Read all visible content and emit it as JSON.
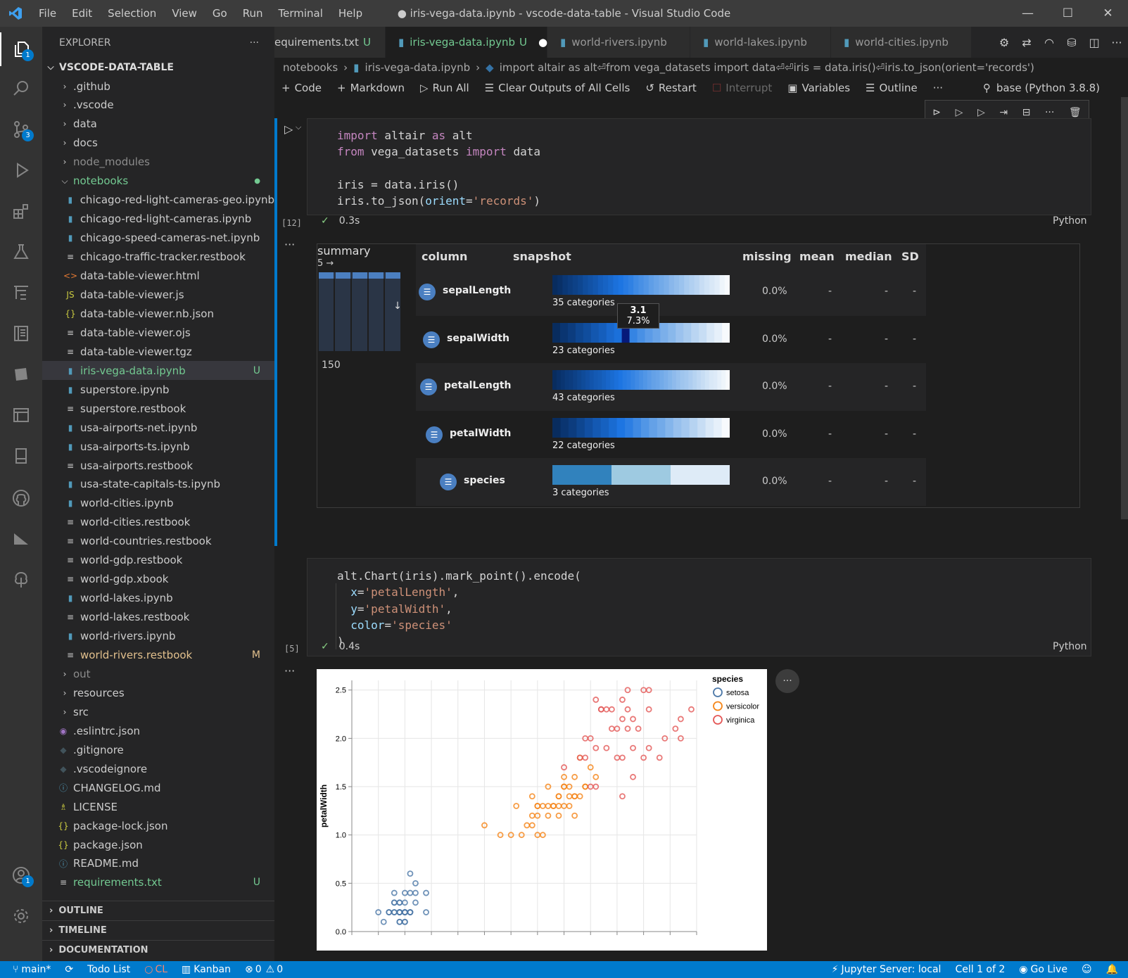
{
  "window": {
    "title": "● iris-vega-data.ipynb - vscode-data-table - Visual Studio Code",
    "menu": [
      "File",
      "Edit",
      "Selection",
      "View",
      "Go",
      "Run",
      "Terminal",
      "Help"
    ]
  },
  "activity": {
    "explorer_badge": "1",
    "scm_badge": "3",
    "account_badge": "1"
  },
  "explorer": {
    "header": "EXPLORER",
    "root": "VSCODE-DATA-TABLE",
    "items": [
      {
        "label": ".github",
        "kind": "folder"
      },
      {
        "label": ".vscode",
        "kind": "folder"
      },
      {
        "label": "data",
        "kind": "folder"
      },
      {
        "label": "docs",
        "kind": "folder"
      },
      {
        "label": "node_modules",
        "kind": "folder"
      },
      {
        "label": "notebooks",
        "kind": "folder-open"
      },
      {
        "label": "chicago-red-light-cameras-geo.ipynb",
        "kind": "nb"
      },
      {
        "label": "chicago-red-light-cameras.ipynb",
        "kind": "nb"
      },
      {
        "label": "chicago-speed-cameras-net.ipynb",
        "kind": "nb"
      },
      {
        "label": "chicago-traffic-tracker.restbook",
        "kind": "rb"
      },
      {
        "label": "data-table-viewer.html",
        "kind": "html"
      },
      {
        "label": "data-table-viewer.js",
        "kind": "js"
      },
      {
        "label": "data-table-viewer.nb.json",
        "kind": "json"
      },
      {
        "label": "data-table-viewer.ojs",
        "kind": "rb"
      },
      {
        "label": "data-table-viewer.tgz",
        "kind": "rb"
      },
      {
        "label": "iris-vega-data.ipynb",
        "kind": "nb",
        "badge": "U"
      },
      {
        "label": "superstore.ipynb",
        "kind": "nb"
      },
      {
        "label": "superstore.restbook",
        "kind": "rb"
      },
      {
        "label": "usa-airports-net.ipynb",
        "kind": "nb"
      },
      {
        "label": "usa-airports-ts.ipynb",
        "kind": "nb"
      },
      {
        "label": "usa-airports.restbook",
        "kind": "rb"
      },
      {
        "label": "usa-state-capitals-ts.ipynb",
        "kind": "nb"
      },
      {
        "label": "world-cities.ipynb",
        "kind": "nb"
      },
      {
        "label": "world-cities.restbook",
        "kind": "rb"
      },
      {
        "label": "world-countries.restbook",
        "kind": "rb"
      },
      {
        "label": "world-gdp.restbook",
        "kind": "rb"
      },
      {
        "label": "world-gdp.xbook",
        "kind": "rb"
      },
      {
        "label": "world-lakes.ipynb",
        "kind": "nb"
      },
      {
        "label": "world-lakes.restbook",
        "kind": "rb"
      },
      {
        "label": "world-rivers.ipynb",
        "kind": "nb"
      },
      {
        "label": "world-rivers.restbook",
        "kind": "rb",
        "badge": "M"
      },
      {
        "label": "out",
        "kind": "folder"
      },
      {
        "label": "resources",
        "kind": "folder"
      },
      {
        "label": "src",
        "kind": "folder"
      },
      {
        "label": ".eslintrc.json",
        "kind": "eslint"
      },
      {
        "label": ".gitignore",
        "kind": "git"
      },
      {
        "label": ".vscodeignore",
        "kind": "git"
      },
      {
        "label": "CHANGELOG.md",
        "kind": "info"
      },
      {
        "label": "LICENSE",
        "kind": "license"
      },
      {
        "label": "package-lock.json",
        "kind": "json"
      },
      {
        "label": "package.json",
        "kind": "json"
      },
      {
        "label": "README.md",
        "kind": "info"
      },
      {
        "label": "requirements.txt",
        "kind": "rb",
        "badge": "U"
      }
    ],
    "sections": [
      "OUTLINE",
      "TIMELINE",
      "DOCUMENTATION"
    ]
  },
  "tabs": [
    {
      "label": "equirements.txt",
      "badge": "U"
    },
    {
      "label": "iris-vega-data.ipynb",
      "badge": "U",
      "dirty": "●"
    },
    {
      "label": "world-rivers.ipynb"
    },
    {
      "label": "world-lakes.ipynb"
    },
    {
      "label": "world-cities.ipynb"
    }
  ],
  "breadcrumbs": [
    "notebooks",
    "iris-vega-data.ipynb",
    "import altair as alt⏎from vega_datasets import data⏎⏎iris = data.iris()⏎iris.to_json(orient='records')"
  ],
  "toolbar": {
    "code": "Code",
    "markdown": "Markdown",
    "run_all": "Run All",
    "clear": "Clear Outputs of All Cells",
    "restart": "Restart",
    "interrupt": "Interrupt",
    "variables": "Variables",
    "outline": "Outline",
    "kernel": "base (Python 3.8.8)"
  },
  "cell1": {
    "count": "[12]",
    "time": "0.3s",
    "lang": "Python"
  },
  "cell2": {
    "count": "[5]",
    "time": "0.4s",
    "lang": "Python"
  },
  "datatable": {
    "summary_label": "summary",
    "summary_cols": "5 →",
    "summary_rows": "150",
    "headers": [
      "column",
      "snapshot",
      "missing",
      "mean",
      "median",
      "SD"
    ],
    "rows": [
      {
        "name": "sepalLength",
        "categories": "35 categories",
        "missing": "0.0%",
        "mean": "-",
        "median": "-",
        "sd": "-"
      },
      {
        "name": "sepalWidth",
        "categories": "23 categories",
        "missing": "0.0%",
        "mean": "-",
        "median": "-",
        "sd": "-"
      },
      {
        "name": "petalLength",
        "categories": "43 categories",
        "missing": "0.0%",
        "mean": "-",
        "median": "-",
        "sd": "-"
      },
      {
        "name": "petalWidth",
        "categories": "22 categories",
        "missing": "0.0%",
        "mean": "-",
        "median": "-",
        "sd": "-"
      },
      {
        "name": "species",
        "categories": "3 categories",
        "missing": "0.0%",
        "mean": "-",
        "median": "-",
        "sd": "-"
      }
    ],
    "tooltip": {
      "value": "3.1",
      "pct": "7.3%"
    }
  },
  "chart_data": {
    "type": "scatter",
    "title": "",
    "xlabel": "",
    "ylabel": "petalWidth",
    "ylim": [
      0,
      2.6
    ],
    "xlim": [
      0.5,
      7.0
    ],
    "yticks": [
      "0.0",
      "0.5",
      "1.0",
      "1.5",
      "2.0",
      "2.5"
    ],
    "grid": true,
    "legend": {
      "title": "species",
      "placement": "right",
      "entries": [
        "setosa",
        "versicolor",
        "virginica"
      ]
    },
    "colors": {
      "setosa": "#4c78a8",
      "versicolor": "#f58518",
      "virginica": "#e45756"
    },
    "series": [
      {
        "name": "setosa",
        "points": [
          [
            1.4,
            0.2
          ],
          [
            1.3,
            0.2
          ],
          [
            1.5,
            0.2
          ],
          [
            1.4,
            0.2
          ],
          [
            1.7,
            0.4
          ],
          [
            1.4,
            0.3
          ],
          [
            1.5,
            0.2
          ],
          [
            1.5,
            0.1
          ],
          [
            1.6,
            0.2
          ],
          [
            1.4,
            0.1
          ],
          [
            1.1,
            0.1
          ],
          [
            1.2,
            0.2
          ],
          [
            1.5,
            0.4
          ],
          [
            1.3,
            0.4
          ],
          [
            1.7,
            0.3
          ],
          [
            1.5,
            0.3
          ],
          [
            1.0,
            0.2
          ],
          [
            1.7,
            0.5
          ],
          [
            1.9,
            0.2
          ],
          [
            1.6,
            0.4
          ],
          [
            1.6,
            0.2
          ],
          [
            1.5,
            0.2
          ],
          [
            1.4,
            0.2
          ],
          [
            1.6,
            0.2
          ],
          [
            1.3,
            0.3
          ],
          [
            1.3,
            0.3
          ],
          [
            1.5,
            0.1
          ],
          [
            1.9,
            0.4
          ],
          [
            1.6,
            0.6
          ],
          [
            1.4,
            0.3
          ],
          [
            1.2,
            0.2
          ],
          [
            1.3,
            0.2
          ],
          [
            1.5,
            0.2
          ],
          [
            1.4,
            0.2
          ],
          [
            1.4,
            0.1
          ]
        ]
      },
      {
        "name": "versicolor",
        "points": [
          [
            4.7,
            1.4
          ],
          [
            4.5,
            1.5
          ],
          [
            4.9,
            1.5
          ],
          [
            4.0,
            1.3
          ],
          [
            4.6,
            1.5
          ],
          [
            4.5,
            1.3
          ],
          [
            4.7,
            1.6
          ],
          [
            3.3,
            1.0
          ],
          [
            4.6,
            1.3
          ],
          [
            3.9,
            1.4
          ],
          [
            3.5,
            1.0
          ],
          [
            4.2,
            1.5
          ],
          [
            4.0,
            1.0
          ],
          [
            4.7,
            1.4
          ],
          [
            3.6,
            1.3
          ],
          [
            4.4,
            1.4
          ],
          [
            4.1,
            1.0
          ],
          [
            4.5,
            1.5
          ],
          [
            3.9,
            1.1
          ],
          [
            4.8,
            1.8
          ],
          [
            4.0,
            1.3
          ],
          [
            4.9,
            1.5
          ],
          [
            4.7,
            1.2
          ],
          [
            4.3,
            1.3
          ],
          [
            4.4,
            1.4
          ],
          [
            4.8,
            1.4
          ],
          [
            5.0,
            1.7
          ],
          [
            3.8,
            1.1
          ],
          [
            3.7,
            1.0
          ],
          [
            3.9,
            1.2
          ],
          [
            5.1,
            1.6
          ],
          [
            4.5,
            1.6
          ],
          [
            4.4,
            1.3
          ],
          [
            4.1,
            1.3
          ],
          [
            4.0,
            1.2
          ],
          [
            4.4,
            1.2
          ],
          [
            4.6,
            1.4
          ],
          [
            3.0,
            1.1
          ],
          [
            4.2,
            1.3
          ],
          [
            4.3,
            1.3
          ],
          [
            4.2,
            1.2
          ]
        ]
      },
      {
        "name": "virginica",
        "points": [
          [
            6.0,
            2.5
          ],
          [
            5.1,
            1.9
          ],
          [
            5.9,
            2.1
          ],
          [
            5.6,
            1.8
          ],
          [
            5.8,
            2.2
          ],
          [
            6.6,
            2.1
          ],
          [
            4.5,
            1.7
          ],
          [
            6.3,
            1.8
          ],
          [
            6.1,
            2.5
          ],
          [
            5.3,
            1.9
          ],
          [
            5.5,
            2.1
          ],
          [
            5.0,
            2.0
          ],
          [
            5.1,
            2.4
          ],
          [
            5.3,
            2.3
          ],
          [
            6.7,
            2.2
          ],
          [
            6.9,
            2.3
          ],
          [
            5.0,
            1.5
          ],
          [
            5.7,
            2.3
          ],
          [
            4.9,
            2.0
          ],
          [
            6.7,
            2.0
          ],
          [
            4.9,
            1.8
          ],
          [
            5.7,
            2.1
          ],
          [
            6.0,
            1.8
          ],
          [
            4.8,
            1.8
          ],
          [
            5.8,
            1.6
          ],
          [
            6.1,
            1.9
          ],
          [
            6.4,
            2.0
          ],
          [
            5.6,
            2.2
          ],
          [
            5.1,
            1.5
          ],
          [
            5.6,
            1.4
          ],
          [
            6.1,
            2.3
          ],
          [
            5.6,
            2.4
          ],
          [
            5.5,
            1.8
          ],
          [
            5.4,
            2.1
          ],
          [
            5.2,
            2.3
          ],
          [
            5.8,
            1.9
          ],
          [
            5.7,
            2.5
          ],
          [
            5.2,
            2.3
          ],
          [
            5.4,
            2.3
          ]
        ]
      }
    ]
  },
  "status": {
    "branch": "main*",
    "todo": "Todo List",
    "cl": "CL",
    "kanban": "Kanban",
    "errors": "0",
    "warnings": "0",
    "jupyter": "Jupyter Server: local",
    "cell": "Cell 1 of 2",
    "golive": "Go Live"
  }
}
